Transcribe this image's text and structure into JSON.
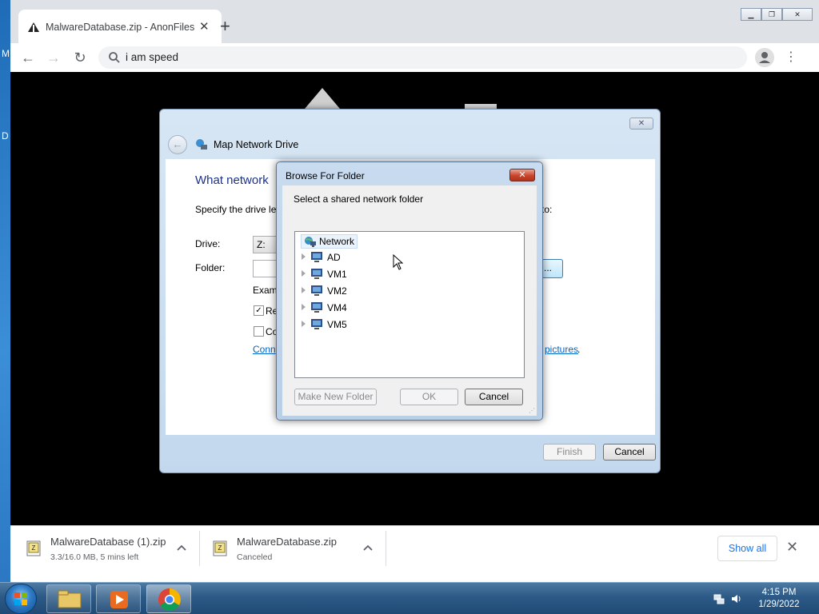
{
  "desktop": {
    "letters": [
      "M",
      "D"
    ]
  },
  "browser": {
    "tab_title": "MalwareDatabase.zip - AnonFiles",
    "omnibox_text": "i am speed"
  },
  "map_drive_dialog": {
    "title": "Map Network Drive",
    "heading": "What network",
    "description": "Specify the drive let",
    "description_tail": "to:",
    "drive_label": "Drive:",
    "drive_value": "Z:",
    "folder_label": "Folder:",
    "browse_label": "...",
    "example_label": "Exam",
    "check1_label": "Re",
    "check1_checked": "✓",
    "check2_label": "Co",
    "link_text": "Conn",
    "link_tail": "pictures",
    "link_tail_period": ".",
    "finish_label": "Finish",
    "cancel_label": "Cancel"
  },
  "browse_dialog": {
    "title": "Browse For Folder",
    "prompt": "Select a shared network folder",
    "close_glyph": "✕",
    "tree_root": "Network",
    "tree_items": [
      "AD",
      "VM1",
      "VM2",
      "VM4",
      "VM5"
    ],
    "new_folder_label": "Make New Folder",
    "ok_label": "OK",
    "cancel_label": "Cancel"
  },
  "downloads": [
    {
      "name": "MalwareDatabase (1).zip",
      "status": "3.3/16.0 MB, 5 mins left"
    },
    {
      "name": "MalwareDatabase.zip",
      "status": "Canceled"
    }
  ],
  "shelf": {
    "show_all_label": "Show all"
  },
  "taskbar": {
    "time": "4:15 PM",
    "date": "1/29/2022"
  },
  "colors": {
    "link": "#0066cc",
    "dialog_heading": "#1e3287",
    "close_red": "#c9442c",
    "chrome_accent": "#1a73e8"
  }
}
